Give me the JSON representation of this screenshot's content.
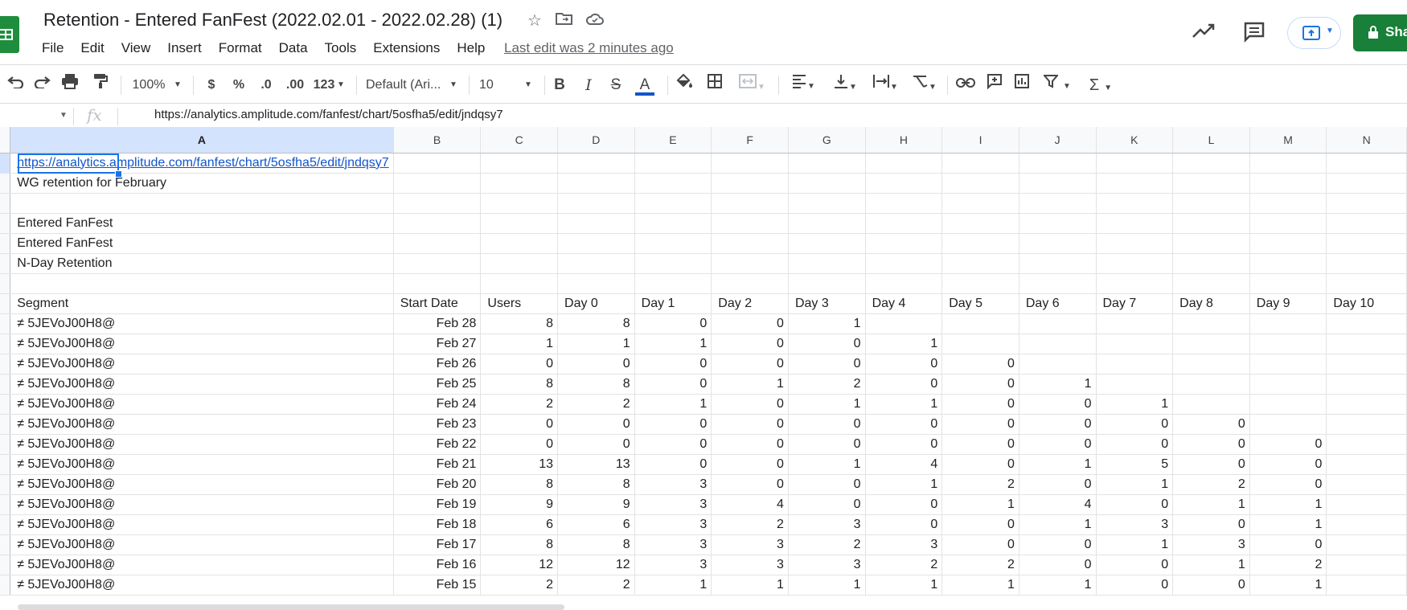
{
  "app": {
    "doc_title": "Retention - Entered FanFest (2022.02.01 - 2022.02.28) (1)",
    "menu": [
      "File",
      "Edit",
      "View",
      "Insert",
      "Format",
      "Data",
      "Tools",
      "Extensions",
      "Help"
    ],
    "last_edit": "Last edit was 2 minutes ago",
    "share_label": "Sha",
    "icons": [
      "sheets-logo-icon",
      "star-icon",
      "move-to-folder-icon",
      "cloud-status-icon",
      "trending-icon",
      "comment-icon",
      "present-icon",
      "lock-icon"
    ]
  },
  "toolbar": {
    "zoom": "100%",
    "currency": "$",
    "percent": "%",
    "decrease_decimal": ".0",
    "increase_decimal": ".00",
    "more_formats": "123",
    "font": "Default (Ari...",
    "font_size": "10",
    "bold": "B",
    "italic": "I",
    "strike": "S",
    "text_color_label": "A",
    "text_color": "#1155cc"
  },
  "formula_bar": {
    "fx": "fx",
    "content": "https://analytics.amplitude.com/fanfest/chart/5osfha5/edit/jndqsy7"
  },
  "sheet": {
    "columns": [
      "A",
      "B",
      "C",
      "D",
      "E",
      "F",
      "G",
      "H",
      "I",
      "J",
      "K",
      "L",
      "M",
      "N"
    ],
    "selected_cell": "A1",
    "rows": [
      [
        "https://analytics.amplitude.com/fanfest/chart/5osfha5/edit/jndqsy7",
        "",
        "",
        "",
        "",
        "",
        "",
        "",
        "",
        "",
        "",
        "",
        "",
        ""
      ],
      [
        "WG retention for February",
        "",
        "",
        "",
        "",
        "",
        "",
        "",
        "",
        "",
        "",
        "",
        "",
        ""
      ],
      [
        "",
        "",
        "",
        "",
        "",
        "",
        "",
        "",
        "",
        "",
        "",
        "",
        "",
        ""
      ],
      [
        "Entered FanFest",
        "",
        "",
        "",
        "",
        "",
        "",
        "",
        "",
        "",
        "",
        "",
        "",
        ""
      ],
      [
        "Entered FanFest",
        "",
        "",
        "",
        "",
        "",
        "",
        "",
        "",
        "",
        "",
        "",
        "",
        ""
      ],
      [
        "N-Day Retention",
        "",
        "",
        "",
        "",
        "",
        "",
        "",
        "",
        "",
        "",
        "",
        "",
        ""
      ],
      [
        "",
        "",
        "",
        "",
        "",
        "",
        "",
        "",
        "",
        "",
        "",
        "",
        "",
        ""
      ],
      [
        "Segment",
        "Start Date",
        "Users",
        "Day 0",
        "Day 1",
        "Day 2",
        "Day 3",
        "Day 4",
        "Day 5",
        "Day 6",
        "Day 7",
        "Day 8",
        "Day 9",
        "Day 10"
      ],
      [
        "≠ 5JEVoJ00H8@",
        "Feb 28",
        "8",
        "8",
        "0",
        "0",
        "1",
        "",
        "",
        "",
        "",
        "",
        "",
        ""
      ],
      [
        "≠ 5JEVoJ00H8@",
        "Feb 27",
        "1",
        "1",
        "1",
        "0",
        "0",
        "1",
        "",
        "",
        "",
        "",
        "",
        ""
      ],
      [
        "≠ 5JEVoJ00H8@",
        "Feb 26",
        "0",
        "0",
        "0",
        "0",
        "0",
        "0",
        "0",
        "",
        "",
        "",
        "",
        ""
      ],
      [
        "≠ 5JEVoJ00H8@",
        "Feb 25",
        "8",
        "8",
        "0",
        "1",
        "2",
        "0",
        "0",
        "1",
        "",
        "",
        "",
        ""
      ],
      [
        "≠ 5JEVoJ00H8@",
        "Feb 24",
        "2",
        "2",
        "1",
        "0",
        "1",
        "1",
        "0",
        "0",
        "1",
        "",
        "",
        ""
      ],
      [
        "≠ 5JEVoJ00H8@",
        "Feb 23",
        "0",
        "0",
        "0",
        "0",
        "0",
        "0",
        "0",
        "0",
        "0",
        "0",
        "",
        ""
      ],
      [
        "≠ 5JEVoJ00H8@",
        "Feb 22",
        "0",
        "0",
        "0",
        "0",
        "0",
        "0",
        "0",
        "0",
        "0",
        "0",
        "0",
        ""
      ],
      [
        "≠ 5JEVoJ00H8@",
        "Feb 21",
        "13",
        "13",
        "0",
        "0",
        "1",
        "4",
        "0",
        "1",
        "5",
        "0",
        "0",
        ""
      ],
      [
        "≠ 5JEVoJ00H8@",
        "Feb 20",
        "8",
        "8",
        "3",
        "0",
        "0",
        "1",
        "2",
        "0",
        "1",
        "2",
        "0",
        ""
      ],
      [
        "≠ 5JEVoJ00H8@",
        "Feb 19",
        "9",
        "9",
        "3",
        "4",
        "0",
        "0",
        "1",
        "4",
        "0",
        "1",
        "1",
        ""
      ],
      [
        "≠ 5JEVoJ00H8@",
        "Feb 18",
        "6",
        "6",
        "3",
        "2",
        "3",
        "0",
        "0",
        "1",
        "3",
        "0",
        "1",
        ""
      ],
      [
        "≠ 5JEVoJ00H8@",
        "Feb 17",
        "8",
        "8",
        "3",
        "3",
        "2",
        "3",
        "0",
        "0",
        "1",
        "3",
        "0",
        ""
      ],
      [
        "≠ 5JEVoJ00H8@",
        "Feb 16",
        "12",
        "12",
        "3",
        "3",
        "3",
        "2",
        "2",
        "0",
        "0",
        "1",
        "2",
        ""
      ],
      [
        "≠ 5JEVoJ00H8@",
        "Feb 15",
        "2",
        "2",
        "1",
        "1",
        "1",
        "1",
        "1",
        "1",
        "0",
        "0",
        "1",
        ""
      ]
    ]
  }
}
